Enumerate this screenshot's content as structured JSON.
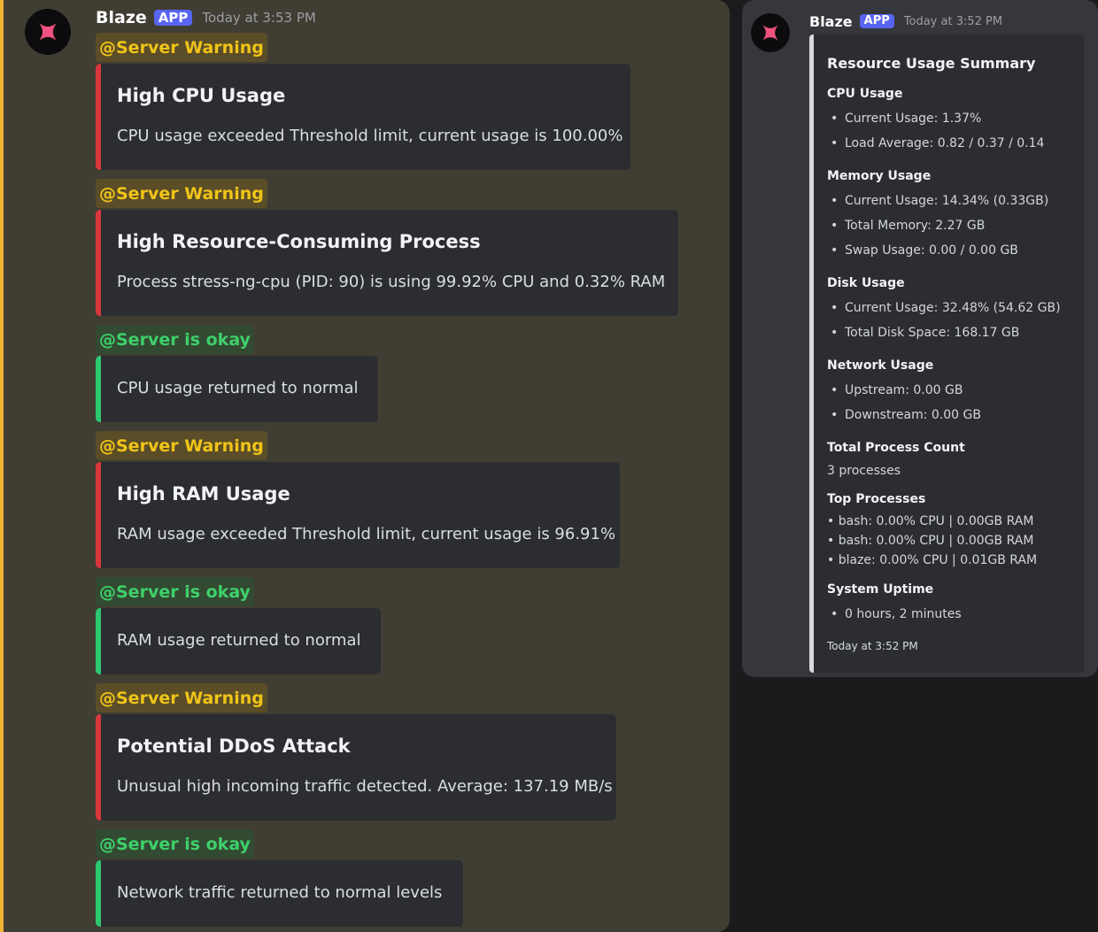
{
  "left_message": {
    "author": "Blaze",
    "app_tag": "APP",
    "timestamp": "Today at 3:53 PM"
  },
  "alerts": [
    {
      "mention": "@Server Warning",
      "title": "High CPU Usage",
      "description": "CPU usage exceeded Threshold limit, current usage is 100.00%"
    },
    {
      "mention": "@Server Warning",
      "title": "High Resource-Consuming Process",
      "description": "Process stress-ng-cpu (PID: 90) is using 99.92% CPU and 0.32% RAM"
    },
    {
      "mention": "@Server is okay",
      "description": "CPU usage returned to normal"
    },
    {
      "mention": "@Server Warning",
      "title": "High RAM Usage",
      "description": "RAM usage exceeded Threshold limit, current usage is 96.91%"
    },
    {
      "mention": "@Server is okay",
      "description": "RAM usage returned to normal"
    },
    {
      "mention": "@Server Warning",
      "title": "Potential DDoS Attack",
      "description": "Unusual high incoming traffic detected. Average: 137.19 MB/s"
    },
    {
      "mention": "@Server is okay",
      "description": "Network traffic returned to normal levels"
    }
  ],
  "right_message": {
    "author": "Blaze",
    "app_tag": "APP",
    "timestamp": "Today at 3:52 PM",
    "summary": {
      "title": "Resource Usage Summary",
      "cpu": {
        "heading": "CPU Usage",
        "items": [
          "Current Usage: 1.37%",
          "Load Average: 0.82 / 0.37 / 0.14"
        ]
      },
      "memory": {
        "heading": "Memory Usage",
        "items": [
          "Current Usage: 14.34% (0.33GB)",
          "Total Memory: 2.27 GB",
          "Swap Usage: 0.00 / 0.00 GB"
        ]
      },
      "disk": {
        "heading": "Disk Usage",
        "items": [
          "Current Usage: 32.48% (54.62 GB)",
          "Total Disk Space: 168.17 GB"
        ]
      },
      "network": {
        "heading": "Network Usage",
        "items": [
          "Upstream: 0.00 GB",
          "Downstream: 0.00 GB"
        ]
      },
      "process_count": {
        "heading": "Total Process Count",
        "value": "3 processes"
      },
      "top_processes": {
        "heading": "Top Processes",
        "items": [
          "• bash: 0.00% CPU | 0.00GB RAM",
          "• bash: 0.00% CPU | 0.00GB RAM",
          "• blaze: 0.00% CPU | 0.01GB RAM"
        ]
      },
      "uptime": {
        "heading": "System Uptime",
        "items": [
          "0 hours, 2 minutes"
        ]
      },
      "footer": "Today at 3:52 PM"
    }
  },
  "colors": {
    "warning_text": "#f0c419",
    "ok_text": "#3ed06a",
    "embed_red": "#da373c",
    "embed_green": "#2dc770",
    "app_tag": "#5865f2",
    "left_accent": "#f0b232"
  },
  "icons": {
    "avatar": "pink-four-point-star-icon"
  }
}
